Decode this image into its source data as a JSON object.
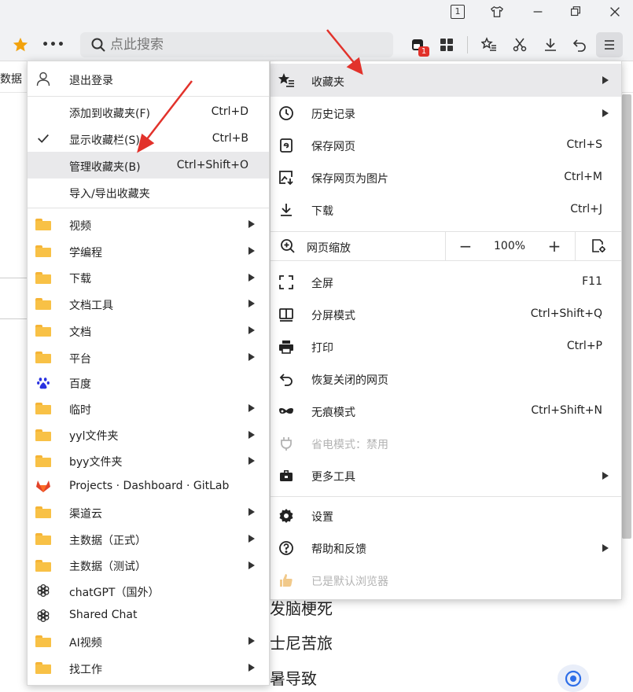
{
  "titlebar": {
    "tab_count": "1"
  },
  "toolbar": {
    "search_placeholder": "点此搜索",
    "notification_badge": "1"
  },
  "background": {
    "left_fragment": "数据",
    "line1": "发脑梗死",
    "line2": "士尼苦旅",
    "line3": "暑导致"
  },
  "main_menu": {
    "items": [
      {
        "label": "收藏夹",
        "shortcut": "",
        "submenu": true,
        "icon": "star-list-icon"
      },
      {
        "label": "历史记录",
        "shortcut": "",
        "submenu": true,
        "icon": "clock-icon"
      },
      {
        "label": "保存网页",
        "shortcut": "Ctrl+S",
        "submenu": false,
        "icon": "save-page-icon"
      },
      {
        "label": "保存网页为图片",
        "shortcut": "Ctrl+M",
        "submenu": false,
        "icon": "save-image-icon"
      },
      {
        "label": "下载",
        "shortcut": "Ctrl+J",
        "submenu": false,
        "icon": "download-icon"
      }
    ],
    "zoom": {
      "label": "网页缩放",
      "value": "100%",
      "minus": "−",
      "plus": "+"
    },
    "items2": [
      {
        "label": "全屏",
        "shortcut": "F11",
        "icon": "fullscreen-icon"
      },
      {
        "label": "分屏模式",
        "shortcut": "Ctrl+Shift+Q",
        "icon": "split-screen-icon"
      },
      {
        "label": "打印",
        "shortcut": "Ctrl+P",
        "icon": "printer-icon"
      },
      {
        "label": "恢复关闭的网页",
        "shortcut": "",
        "icon": "undo-icon"
      },
      {
        "label": "无痕模式",
        "shortcut": "Ctrl+Shift+N",
        "icon": "incognito-icon"
      },
      {
        "label": "省电模式：禁用",
        "shortcut": "",
        "icon": "power-plug-icon"
      },
      {
        "label": "更多工具",
        "shortcut": "",
        "icon": "toolbox-icon"
      }
    ],
    "items3": [
      {
        "label": "设置",
        "icon": "gear-icon"
      },
      {
        "label": "帮助和反馈",
        "icon": "help-icon"
      },
      {
        "label": "已是默认浏览器",
        "icon": "thumbs-up-icon"
      }
    ]
  },
  "fav_menu": {
    "logout": "退出登录",
    "actions": [
      {
        "label": "添加到收藏夹(F)",
        "shortcut": "Ctrl+D"
      },
      {
        "label": "显示收藏栏(S)",
        "shortcut": "Ctrl+B"
      },
      {
        "label": "管理收藏夹(B)",
        "shortcut": "Ctrl+Shift+O"
      },
      {
        "label": "导入/导出收藏夹",
        "shortcut": ""
      }
    ],
    "folders": [
      {
        "label": "视频",
        "type": "folder"
      },
      {
        "label": "学编程",
        "type": "folder"
      },
      {
        "label": "下载",
        "type": "folder"
      },
      {
        "label": "文档工具",
        "type": "folder"
      },
      {
        "label": "文档",
        "type": "folder"
      },
      {
        "label": "平台",
        "type": "folder"
      },
      {
        "label": "百度",
        "type": "baidu"
      },
      {
        "label": "临时",
        "type": "folder"
      },
      {
        "label": "yyl文件夹",
        "type": "folder"
      },
      {
        "label": "byy文件夹",
        "type": "folder"
      },
      {
        "label": "Projects · Dashboard · GitLab",
        "type": "gitlab"
      },
      {
        "label": "渠道云",
        "type": "folder"
      },
      {
        "label": "主数据（正式）",
        "type": "folder"
      },
      {
        "label": "主数据（测试）",
        "type": "folder"
      },
      {
        "label": "chatGPT（国外）",
        "type": "openai"
      },
      {
        "label": "Shared Chat",
        "type": "openai"
      },
      {
        "label": "AI视频",
        "type": "folder"
      },
      {
        "label": "找工作",
        "type": "folder"
      }
    ]
  },
  "colors": {
    "accent_red": "#e2322b",
    "star_orange": "#f2a20c",
    "folder_yellow": "#f8c146"
  }
}
